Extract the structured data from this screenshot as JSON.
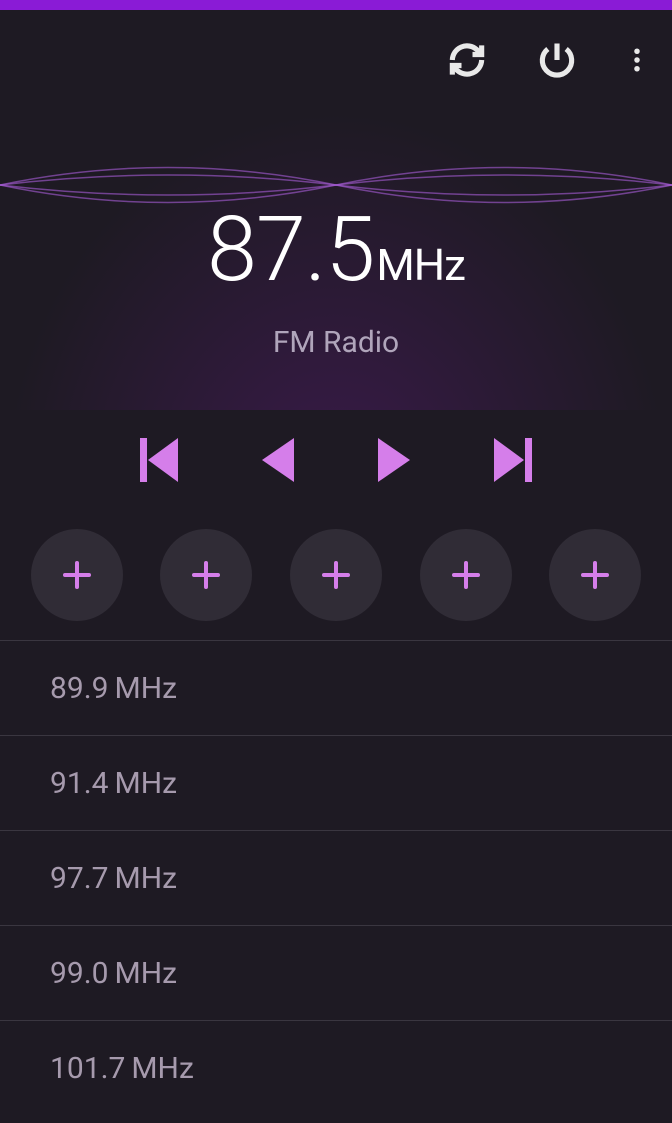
{
  "colors": {
    "accent": "#d57eea",
    "status_bar": "#8a1bd6"
  },
  "current": {
    "frequency": "87.5",
    "unit": "MHz",
    "label": "FM Radio"
  },
  "presets": [
    "+",
    "+",
    "+",
    "+",
    "+"
  ],
  "stations": [
    "89.9",
    "91.4",
    "97.7",
    "99.0",
    "101.7"
  ],
  "station_unit": "MHz"
}
